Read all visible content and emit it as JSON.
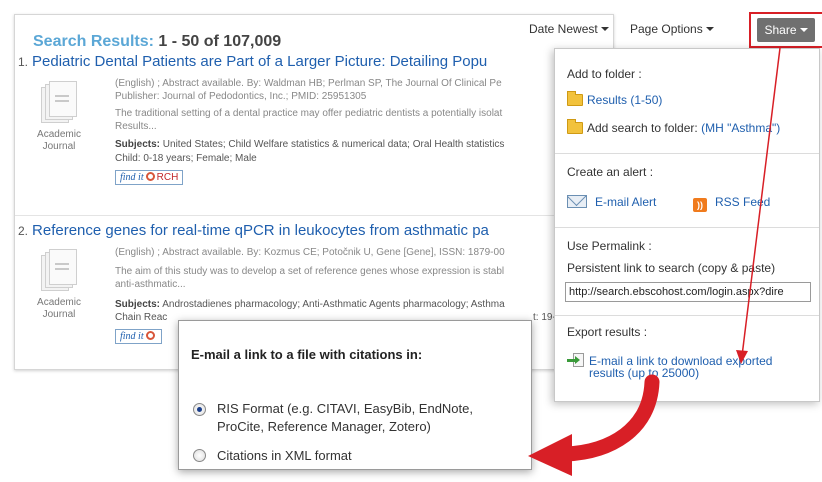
{
  "toolbar": {
    "sort_label": "Date Newest",
    "page_options_label": "Page Options",
    "share_label": "Share"
  },
  "results": {
    "heading_label": "Search Results:",
    "heading_count": "1 - 50 of 107,009",
    "records": [
      {
        "number": "1.",
        "title": "Pediatric Dental Patients are Part of a Larger Picture: Detailing Popu",
        "doc_type_line1": "Academic",
        "doc_type_line2": "Journal",
        "meta_line1": "(English) ; Abstract available. By: Waldman HB; Perlman SP, The Journal Of Clinical Pe",
        "meta_line2": "Publisher: Journal of Pedodontics, Inc.; PMID: 25951305",
        "abstract_line1": "The traditional setting of a dental practice may offer pediatric dentists a potentially isolat",
        "abstract_line2": "Results...",
        "subjects_label": "Subjects:",
        "subjects_line1": "United States; Child Welfare statistics & numerical data; Oral Health statistics",
        "subjects_line2": "Child: 0-18 years; Female; Male",
        "findit_label": "find it",
        "findit_source": "RCH"
      },
      {
        "number": "2.",
        "title": "Reference genes for real-time qPCR in leukocytes from asthmatic pa",
        "doc_type_line1": "Academic",
        "doc_type_line2": "Journal",
        "meta_line1": "(English) ; Abstract available. By: Kozmus CE; Potočnik U, Gene [Gene], ISSN: 1879-00",
        "abstract_line1": "The aim of this study was to develop a set of reference genes whose expression is stabl",
        "abstract_line2": "anti-asthmatic...",
        "subjects_label": "Subjects:",
        "subjects_line1": "Androstadienes pharmacology; Anti-Asthmatic Agents pharmacology; Asthma",
        "subjects_line2": "Chain Reac",
        "subjects_line2_tail": "t: 19-",
        "findit_label": "find it"
      }
    ]
  },
  "share_panel": {
    "add_to_folder_header": "Add to folder :",
    "results_link": "Results (1-50)",
    "add_search_label": "Add search to folder:",
    "add_search_link": "(MH \"Asthma\")",
    "create_alert_header": "Create an alert :",
    "email_alert_label": "E-mail Alert",
    "rss_feed_label": "RSS Feed",
    "permalink_header": "Use Permalink :",
    "permalink_desc": "Persistent link to search (copy & paste)",
    "permalink_value": "http://search.ebscohost.com/login.aspx?dire",
    "export_header": "Export results :",
    "export_link_line1": "E-mail a link to download exported",
    "export_link_line2": "results (up to 25000)"
  },
  "email_popup": {
    "title": "E-mail a link to a file with citations in:",
    "option1_line1": "RIS Format (e.g. CITAVI, EasyBib, EndNote,",
    "option1_line2": "ProCite, Reference Manager, Zotero)",
    "option2": "Citations in XML format"
  },
  "colors": {
    "accent_blue": "#1f5fae",
    "heading_blue": "#5ba7d6",
    "highlight_red": "#d81f26",
    "share_button_gray": "#707070"
  }
}
